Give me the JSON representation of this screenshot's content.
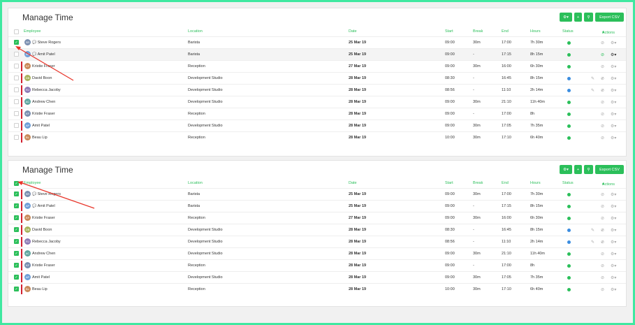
{
  "panels": [
    {
      "title": "Manage Time",
      "buttons": {
        "settings": "⚙▾",
        "add": "+",
        "search": "⚲",
        "export": "Export CSV"
      },
      "headers": {
        "employee": "Employee",
        "location": "Location",
        "date": "Date",
        "start": "Start",
        "break": "Break",
        "end": "End",
        "hours": "Hours",
        "status": "Status",
        "actions": "Actions"
      },
      "header_checked": false,
      "rows": [
        {
          "initials": "SR",
          "name": "Steve Rogers",
          "comment": true,
          "location": "Barista",
          "date": "25 Mar 19",
          "start": "09:00",
          "break": "30m",
          "end": "17:00",
          "hours": "7h 30m",
          "status": "green",
          "checked": true,
          "bar": false
        },
        {
          "initials": "AP",
          "name": "Amit Patel",
          "comment": true,
          "location": "Barista",
          "date": "25 Mar 19",
          "start": "09:00",
          "break": "-",
          "end": "17:15",
          "hours": "8h 15m",
          "status": "green",
          "checked": false,
          "bar": false
        },
        {
          "initials": "KF",
          "name": "Kristie Fraser",
          "comment": false,
          "location": "Reception",
          "date": "27 Mar 19",
          "start": "09:00",
          "break": "30m",
          "end": "16:00",
          "hours": "6h 30m",
          "status": "green",
          "checked": false,
          "bar": true
        },
        {
          "initials": "DB",
          "name": "David Boon",
          "comment": false,
          "location": "Development Studio",
          "date": "28 Mar 19",
          "start": "08:30",
          "break": "-",
          "end": "16:45",
          "hours": "8h 15m",
          "status": "blue",
          "checked": false,
          "bar": true
        },
        {
          "initials": "RJ",
          "name": "Rebecca Jacoby",
          "comment": false,
          "location": "Development Studio",
          "date": "28 Mar 19",
          "start": "08:56",
          "break": "-",
          "end": "11:10",
          "hours": "2h 14m",
          "status": "blue",
          "checked": false,
          "bar": true
        },
        {
          "initials": "AC",
          "name": "Andrew Chen",
          "comment": false,
          "location": "Development Studio",
          "date": "28 Mar 19",
          "start": "09:00",
          "break": "30m",
          "end": "21:10",
          "hours": "11h 40m",
          "status": "green",
          "checked": false,
          "bar": true
        },
        {
          "initials": "KF",
          "name": "Kristie Fraser",
          "comment": false,
          "location": "Reception",
          "date": "28 Mar 19",
          "start": "09:00",
          "break": "-",
          "end": "17:00",
          "hours": "8h",
          "status": "green",
          "checked": false,
          "bar": true
        },
        {
          "initials": "AP",
          "name": "Amit Patel",
          "comment": false,
          "location": "Development Studio",
          "date": "28 Mar 19",
          "start": "09:00",
          "break": "30m",
          "end": "17:05",
          "hours": "7h 35m",
          "status": "green",
          "checked": false,
          "bar": true
        },
        {
          "initials": "BL",
          "name": "Beau Lip",
          "comment": false,
          "location": "Reception",
          "date": "28 Mar 19",
          "start": "10:00",
          "break": "30m",
          "end": "17:10",
          "hours": "6h 40m",
          "status": "green",
          "checked": false,
          "bar": true
        }
      ]
    },
    {
      "title": "Manage Time",
      "buttons": {
        "settings": "⚙▾",
        "add": "+",
        "search": "⚲",
        "export": "Export CSV"
      },
      "headers": {
        "employee": "Employee",
        "location": "Location",
        "date": "Date",
        "start": "Start",
        "break": "Break",
        "end": "End",
        "hours": "Hours",
        "status": "Status",
        "actions": "Actions"
      },
      "header_checked": true,
      "rows": [
        {
          "initials": "SR",
          "name": "Steve Rogers",
          "comment": true,
          "location": "Barista",
          "date": "25 Mar 19",
          "start": "09:00",
          "break": "30m",
          "end": "17:00",
          "hours": "7h 30m",
          "status": "green",
          "checked": true,
          "bar": true
        },
        {
          "initials": "AP",
          "name": "Amit Patel",
          "comment": true,
          "location": "Barista",
          "date": "25 Mar 19",
          "start": "09:00",
          "break": "-",
          "end": "17:15",
          "hours": "8h 15m",
          "status": "green",
          "checked": true,
          "bar": true
        },
        {
          "initials": "KF",
          "name": "Kristie Fraser",
          "comment": false,
          "location": "Reception",
          "date": "27 Mar 19",
          "start": "09:00",
          "break": "30m",
          "end": "16:00",
          "hours": "6h 30m",
          "status": "green",
          "checked": true,
          "bar": true
        },
        {
          "initials": "DB",
          "name": "David Boon",
          "comment": false,
          "location": "Development Studio",
          "date": "28 Mar 19",
          "start": "08:30",
          "break": "-",
          "end": "16:45",
          "hours": "8h 15m",
          "status": "blue",
          "checked": true,
          "bar": true
        },
        {
          "initials": "RJ",
          "name": "Rebecca Jacoby",
          "comment": false,
          "location": "Development Studio",
          "date": "28 Mar 19",
          "start": "08:56",
          "break": "-",
          "end": "11:10",
          "hours": "2h 14m",
          "status": "blue",
          "checked": true,
          "bar": true
        },
        {
          "initials": "AC",
          "name": "Andrew Chen",
          "comment": false,
          "location": "Development Studio",
          "date": "28 Mar 19",
          "start": "09:00",
          "break": "30m",
          "end": "21:10",
          "hours": "11h 40m",
          "status": "green",
          "checked": true,
          "bar": true
        },
        {
          "initials": "KF",
          "name": "Kristie Fraser",
          "comment": false,
          "location": "Reception",
          "date": "28 Mar 19",
          "start": "09:00",
          "break": "-",
          "end": "17:00",
          "hours": "8h",
          "status": "green",
          "checked": true,
          "bar": true
        },
        {
          "initials": "AP",
          "name": "Amit Patel",
          "comment": false,
          "location": "Development Studio",
          "date": "28 Mar 19",
          "start": "09:00",
          "break": "30m",
          "end": "17:05",
          "hours": "7h 35m",
          "status": "green",
          "checked": true,
          "bar": true
        },
        {
          "initials": "BL",
          "name": "Beau Lip",
          "comment": false,
          "location": "Reception",
          "date": "28 Mar 19",
          "start": "10:00",
          "break": "30m",
          "end": "17:10",
          "hours": "6h 40m",
          "status": "green",
          "checked": true,
          "bar": true
        }
      ]
    }
  ],
  "colors": {
    "accent": "#2bbf5a",
    "bar": "#d2202f",
    "status_green": "#2bbf5a",
    "status_blue": "#3b8de0",
    "arrow": "#e8352a",
    "border": "#3fe8a0"
  }
}
